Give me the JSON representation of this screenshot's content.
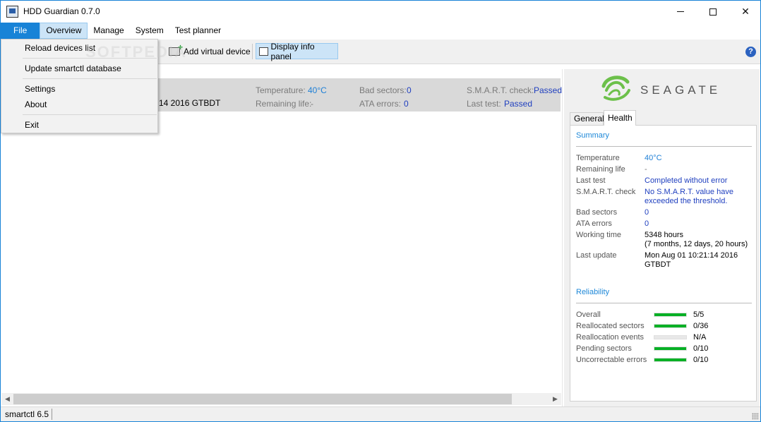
{
  "window": {
    "title": "HDD Guardian 0.7.0"
  },
  "menu": [
    "File",
    "Overview",
    "Manage",
    "System",
    "Test planner"
  ],
  "file_menu": [
    "Reload devices list",
    "Update smartctl database",
    "Settings",
    "About",
    "Exit"
  ],
  "toolbar": {
    "partial_label": "s",
    "add_virtual": "Add virtual device",
    "display_info": "Display info panel",
    "help": "?"
  },
  "device": {
    "date_partial": "14 2016 GTBDT",
    "temperature_label": "Temperature:",
    "temperature": "40°C",
    "remaining_life_label": "Remaining life:",
    "remaining_life": "-",
    "bad_sectors_label": "Bad sectors:",
    "bad_sectors": "0",
    "ata_errors_label": "ATA errors:",
    "ata_errors": "0",
    "smart_check_label": "S.M.A.R.T. check:",
    "smart_check": "Passed",
    "last_test_label": "Last test:",
    "last_test": "Passed"
  },
  "panel": {
    "brand": "SEAGATE",
    "tabs": [
      "General",
      "Health"
    ],
    "summary_title": "Summary",
    "summary": [
      {
        "label": "Temperature",
        "value": "40°C"
      },
      {
        "label": "Remaining life",
        "value": "-"
      },
      {
        "label": "Last test",
        "value": "Completed without error"
      },
      {
        "label": "S.M.A.R.T. check",
        "value": "No S.M.A.R.T. value have",
        "value2": "exceeded the threshold."
      },
      {
        "label": "Bad sectors",
        "value": "0"
      },
      {
        "label": "ATA errors",
        "value": "0"
      },
      {
        "label": "Working time",
        "value": "5348 hours",
        "value2": "(7 months, 12 days, 20 hours)"
      },
      {
        "label": "Last update",
        "value": "Mon Aug 01 10:21:14 2016",
        "value2": "GTBDT"
      }
    ],
    "reliability_title": "Reliability",
    "reliability": [
      {
        "label": "Overall",
        "value": "5/5",
        "fill": 1.0
      },
      {
        "label": "Reallocated sectors",
        "value": "0/36",
        "fill": 1.0
      },
      {
        "label": "Reallocation events",
        "value": "N/A",
        "fill": 0.0
      },
      {
        "label": "Pending sectors",
        "value": "0/10",
        "fill": 1.0
      },
      {
        "label": "Uncorrectable errors",
        "value": "0/10",
        "fill": 1.0
      }
    ]
  },
  "status": {
    "text": "smartctl 6.5"
  },
  "watermark": "SOFTPEDIA",
  "colors": {
    "accent": "#1883d7",
    "bar_green": "#06b025",
    "link_blue": "#1e88d8"
  }
}
